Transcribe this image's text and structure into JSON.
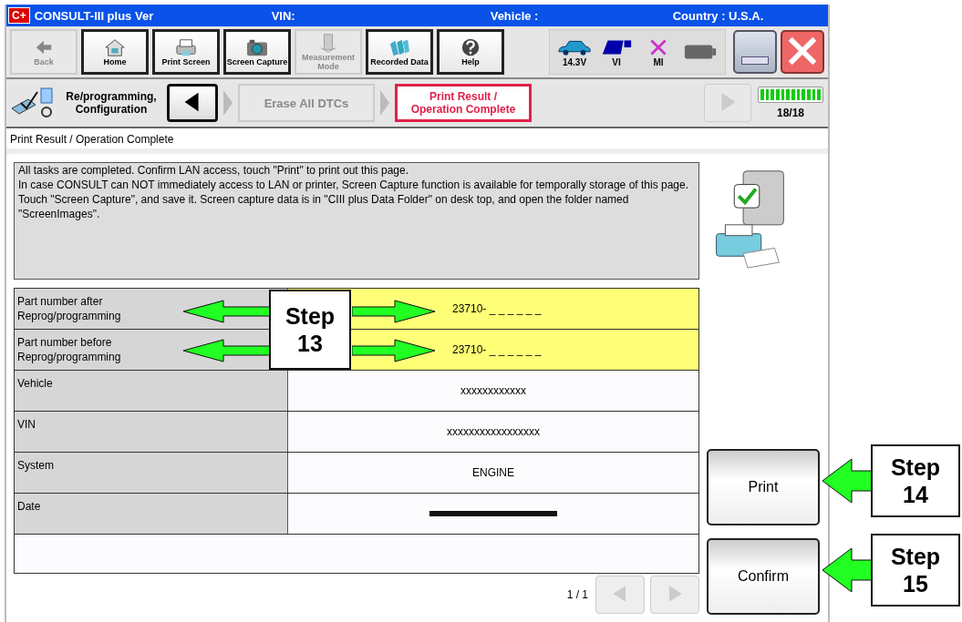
{
  "window": {
    "logo": "C+",
    "title": "CONSULT-III plus  Ver",
    "vin_label": "VIN:",
    "vehicle_label": "Vehicle :",
    "country": "Country : U.S.A."
  },
  "toolbar": [
    {
      "label": "Back",
      "kind": "back",
      "disabled": true
    },
    {
      "label": "Home",
      "kind": "home",
      "disabled": false
    },
    {
      "label": "Print Screen",
      "kind": "printer",
      "disabled": false
    },
    {
      "label": "Screen Capture",
      "kind": "camera",
      "disabled": false
    },
    {
      "label": "Measurement Mode",
      "kind": "meter",
      "disabled": true
    },
    {
      "label": "Recorded Data",
      "kind": "folders",
      "disabled": false
    },
    {
      "label": "Help",
      "kind": "help",
      "disabled": false
    }
  ],
  "status": [
    {
      "label": "14.3V",
      "kind": "car"
    },
    {
      "label": "VI",
      "kind": "vi"
    },
    {
      "label": "MI",
      "kind": "mi"
    },
    {
      "kind": "battery"
    }
  ],
  "breadcrumb": {
    "label": "Re/programming, Configuration",
    "steps": [
      {
        "label": "Erase All DTCs",
        "selected": false
      },
      {
        "label": "Print Result / Operation Complete",
        "selected": true
      }
    ],
    "forward_disabled": true,
    "progress": {
      "level": 1,
      "text": "18/18"
    }
  },
  "heading": "Print Result / Operation Complete",
  "message": "All tasks are completed. Confirm LAN access, touch \"Print\" to print out this page.\nIn case CONSULT can NOT immediately access to LAN or printer, Screen Capture function is available for temporally storage of this page. Touch \"Screen Capture\", and save it. Screen capture data is in \"CIII plus Data Folder\" on desk top, and open the folder named \"ScreenImages\".",
  "table": [
    {
      "label": "Part number after Reprog/programming",
      "value": "23710- _ _ _ _ _ _",
      "highlighted": true,
      "redacted": false
    },
    {
      "label": "Part number before Reprog/programming",
      "value": "23710- _ _ _ _ _ _",
      "highlighted": true,
      "redacted": false
    },
    {
      "label": "Vehicle",
      "value": "xxxxxxxxxxxx",
      "highlighted": false,
      "redacted": false
    },
    {
      "label": "VIN",
      "value": "xxxxxxxxxxxxxxxxx",
      "highlighted": false,
      "redacted": false
    },
    {
      "label": "System",
      "value": "ENGINE",
      "highlighted": false,
      "redacted": false
    },
    {
      "label": "Date",
      "highlighted": false,
      "redacted": true
    }
  ],
  "pager": {
    "text": "1 / 1",
    "prev_disabled": true,
    "next_disabled": true
  },
  "buttons": [
    "Print",
    "Confirm"
  ],
  "callouts": [
    {
      "label": "Step 13"
    },
    {
      "label": "Step 14"
    },
    {
      "label": "Step 15"
    }
  ]
}
